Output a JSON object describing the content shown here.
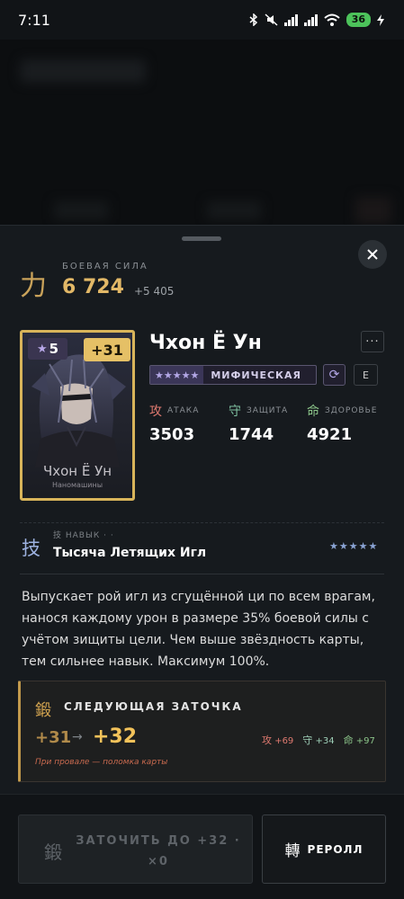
{
  "status_bar": {
    "time": "7:11",
    "battery": "36"
  },
  "power": {
    "glyph": "力",
    "label": "БОЕВАЯ СИЛА",
    "value": "6 724",
    "delta": "+5 405"
  },
  "card": {
    "stars": "5",
    "level": "+31",
    "name": "Чхон Ё Ун",
    "subtitle": "Наномашины"
  },
  "hero": {
    "name": "Чхон Ё Ун",
    "more_label": "···",
    "rarity_stars": "★★★★★",
    "rarity_label": "МИФИЧЕСКАЯ",
    "refresh_icon": "⟳",
    "e_label": "E"
  },
  "stats": [
    {
      "glyph": "攻",
      "label": "АТАКА",
      "value": "3503",
      "color": "#e07a70"
    },
    {
      "glyph": "守",
      "label": "ЗАЩИТА",
      "value": "1744",
      "color": "#7fc0a0"
    },
    {
      "glyph": "命",
      "label": "ЗДОРОВЬЕ",
      "value": "4921",
      "color": "#8cc58a"
    }
  ],
  "skill": {
    "glyph": "技",
    "label": "技 НАВЫК · ·",
    "name": "Тысяча Летящих Игл",
    "stars": "★★★★★",
    "description": "Выпускает рой игл из сгущённой ци по всем врагам, нанося каждому урон в размере 35% боевой силы с учётом зищиты цели. Чем выше звёздность карты, тем сильнее навык. Максимум 100%."
  },
  "upgrade": {
    "glyph": "鍛",
    "title": "СЛЕДУЮЩАЯ ЗАТОЧКА",
    "from": "+31",
    "arrow": "→",
    "to": "+32",
    "bonuses": [
      {
        "glyph": "攻",
        "value": "+69",
        "color": "#e07a70"
      },
      {
        "glyph": "守",
        "value": "+34",
        "color": "#9fd0b8"
      },
      {
        "glyph": "命",
        "value": "+97",
        "color": "#8cc58a"
      }
    ],
    "note": "При провале — поломка карты"
  },
  "actions": {
    "upgrade_glyph": "鍛",
    "upgrade_label": "ЗАТОЧИТЬ ДО +32 · ×0",
    "reroll_glyph": "轉",
    "reroll_label": "РЕРОЛЛ"
  }
}
